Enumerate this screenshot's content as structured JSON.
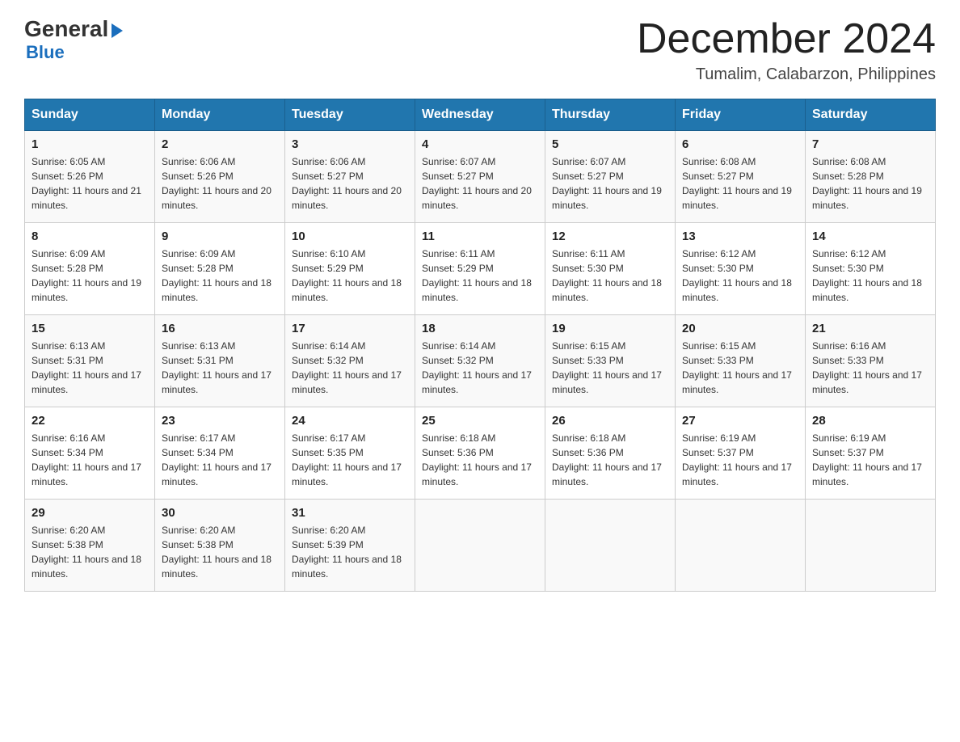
{
  "header": {
    "logo_general": "General",
    "logo_blue": "Blue",
    "month_title": "December 2024",
    "location": "Tumalim, Calabarzon, Philippines"
  },
  "days_of_week": [
    "Sunday",
    "Monday",
    "Tuesday",
    "Wednesday",
    "Thursday",
    "Friday",
    "Saturday"
  ],
  "weeks": [
    [
      {
        "day": "1",
        "sunrise": "6:05 AM",
        "sunset": "5:26 PM",
        "daylight": "11 hours and 21 minutes."
      },
      {
        "day": "2",
        "sunrise": "6:06 AM",
        "sunset": "5:26 PM",
        "daylight": "11 hours and 20 minutes."
      },
      {
        "day": "3",
        "sunrise": "6:06 AM",
        "sunset": "5:27 PM",
        "daylight": "11 hours and 20 minutes."
      },
      {
        "day": "4",
        "sunrise": "6:07 AM",
        "sunset": "5:27 PM",
        "daylight": "11 hours and 20 minutes."
      },
      {
        "day": "5",
        "sunrise": "6:07 AM",
        "sunset": "5:27 PM",
        "daylight": "11 hours and 19 minutes."
      },
      {
        "day": "6",
        "sunrise": "6:08 AM",
        "sunset": "5:27 PM",
        "daylight": "11 hours and 19 minutes."
      },
      {
        "day": "7",
        "sunrise": "6:08 AM",
        "sunset": "5:28 PM",
        "daylight": "11 hours and 19 minutes."
      }
    ],
    [
      {
        "day": "8",
        "sunrise": "6:09 AM",
        "sunset": "5:28 PM",
        "daylight": "11 hours and 19 minutes."
      },
      {
        "day": "9",
        "sunrise": "6:09 AM",
        "sunset": "5:28 PM",
        "daylight": "11 hours and 18 minutes."
      },
      {
        "day": "10",
        "sunrise": "6:10 AM",
        "sunset": "5:29 PM",
        "daylight": "11 hours and 18 minutes."
      },
      {
        "day": "11",
        "sunrise": "6:11 AM",
        "sunset": "5:29 PM",
        "daylight": "11 hours and 18 minutes."
      },
      {
        "day": "12",
        "sunrise": "6:11 AM",
        "sunset": "5:30 PM",
        "daylight": "11 hours and 18 minutes."
      },
      {
        "day": "13",
        "sunrise": "6:12 AM",
        "sunset": "5:30 PM",
        "daylight": "11 hours and 18 minutes."
      },
      {
        "day": "14",
        "sunrise": "6:12 AM",
        "sunset": "5:30 PM",
        "daylight": "11 hours and 18 minutes."
      }
    ],
    [
      {
        "day": "15",
        "sunrise": "6:13 AM",
        "sunset": "5:31 PM",
        "daylight": "11 hours and 17 minutes."
      },
      {
        "day": "16",
        "sunrise": "6:13 AM",
        "sunset": "5:31 PM",
        "daylight": "11 hours and 17 minutes."
      },
      {
        "day": "17",
        "sunrise": "6:14 AM",
        "sunset": "5:32 PM",
        "daylight": "11 hours and 17 minutes."
      },
      {
        "day": "18",
        "sunrise": "6:14 AM",
        "sunset": "5:32 PM",
        "daylight": "11 hours and 17 minutes."
      },
      {
        "day": "19",
        "sunrise": "6:15 AM",
        "sunset": "5:33 PM",
        "daylight": "11 hours and 17 minutes."
      },
      {
        "day": "20",
        "sunrise": "6:15 AM",
        "sunset": "5:33 PM",
        "daylight": "11 hours and 17 minutes."
      },
      {
        "day": "21",
        "sunrise": "6:16 AM",
        "sunset": "5:33 PM",
        "daylight": "11 hours and 17 minutes."
      }
    ],
    [
      {
        "day": "22",
        "sunrise": "6:16 AM",
        "sunset": "5:34 PM",
        "daylight": "11 hours and 17 minutes."
      },
      {
        "day": "23",
        "sunrise": "6:17 AM",
        "sunset": "5:34 PM",
        "daylight": "11 hours and 17 minutes."
      },
      {
        "day": "24",
        "sunrise": "6:17 AM",
        "sunset": "5:35 PM",
        "daylight": "11 hours and 17 minutes."
      },
      {
        "day": "25",
        "sunrise": "6:18 AM",
        "sunset": "5:36 PM",
        "daylight": "11 hours and 17 minutes."
      },
      {
        "day": "26",
        "sunrise": "6:18 AM",
        "sunset": "5:36 PM",
        "daylight": "11 hours and 17 minutes."
      },
      {
        "day": "27",
        "sunrise": "6:19 AM",
        "sunset": "5:37 PM",
        "daylight": "11 hours and 17 minutes."
      },
      {
        "day": "28",
        "sunrise": "6:19 AM",
        "sunset": "5:37 PM",
        "daylight": "11 hours and 17 minutes."
      }
    ],
    [
      {
        "day": "29",
        "sunrise": "6:20 AM",
        "sunset": "5:38 PM",
        "daylight": "11 hours and 18 minutes."
      },
      {
        "day": "30",
        "sunrise": "6:20 AM",
        "sunset": "5:38 PM",
        "daylight": "11 hours and 18 minutes."
      },
      {
        "day": "31",
        "sunrise": "6:20 AM",
        "sunset": "5:39 PM",
        "daylight": "11 hours and 18 minutes."
      },
      null,
      null,
      null,
      null
    ]
  ]
}
